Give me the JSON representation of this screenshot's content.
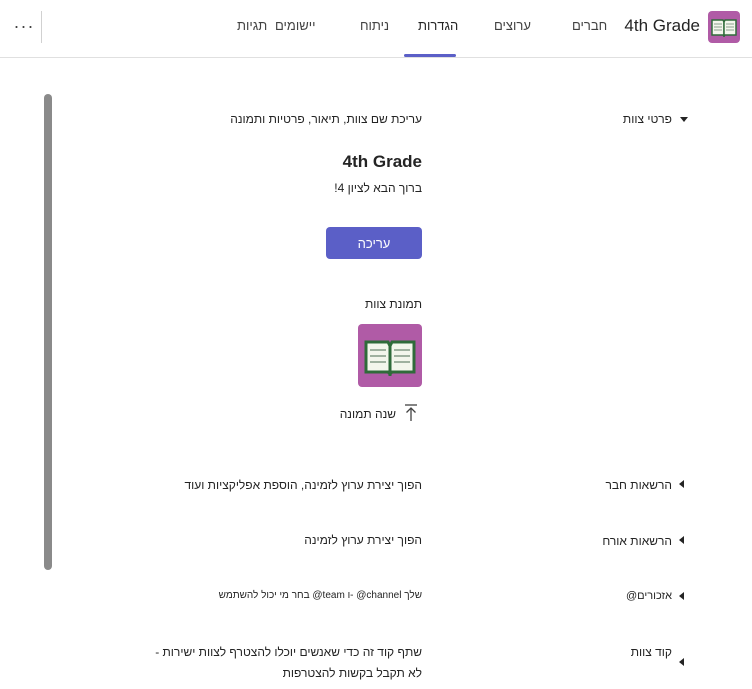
{
  "header": {
    "team_name": "4th Grade",
    "tabs": [
      {
        "label": "חברים"
      },
      {
        "label": "ערוצים"
      },
      {
        "label": "הגדרות"
      },
      {
        "label": "ניתוח"
      },
      {
        "label": "יישומים"
      },
      {
        "label": "תגיות"
      }
    ],
    "active_tab": "הגדרות",
    "more_label": "···",
    "icons": {
      "team_logo": "book-icon",
      "more": "more-icon"
    }
  },
  "team_details": {
    "label": "פרטי צוות",
    "description": "עריכת שם צוות, תיאור, פרטיות ותמונה",
    "team_title": "4th Grade",
    "team_description": "ברוך הבא לציון 4!",
    "edit_button": "עריכה",
    "picture_label": "תמונת צוות",
    "change_picture": "שנה תמונה"
  },
  "sections": {
    "member_permissions": {
      "label": "הרשאות חבר",
      "description": "הפוך יצירת ערוץ לזמינה, הוספת אפליקציות ועוד"
    },
    "guest_permissions": {
      "label": "הרשאות אורח",
      "description": "הפוך יצירת ערוץ לזמינה"
    },
    "mentions": {
      "label": "@אזכורים",
      "description": "בחר מי יכול להשתמש @team ו- @channel שלך"
    },
    "team_code": {
      "label": "קוד צוות",
      "description_line1": "שתף קוד זה כדי שאנשים יוכלו להצטרף לצוות ישירות -",
      "description_line2": "לא תקבל בקשות להצטרפות"
    }
  },
  "colors": {
    "accent": "#5b5fc7",
    "team_logo_bg": "#b05ba6",
    "scrollbar": "#8a8a8a"
  }
}
